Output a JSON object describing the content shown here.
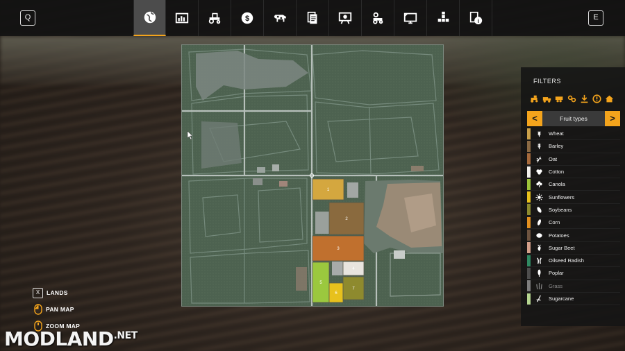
{
  "topbar": {
    "left_key": "Q",
    "right_key": "E",
    "tabs": [
      {
        "icon": "globe-icon",
        "active": true
      },
      {
        "icon": "chart-icon",
        "active": false
      },
      {
        "icon": "tractor-icon",
        "active": false
      },
      {
        "icon": "dollar-icon",
        "active": false
      },
      {
        "icon": "cow-icon",
        "active": false
      },
      {
        "icon": "contracts-icon",
        "active": false
      },
      {
        "icon": "presentation-icon",
        "active": false
      },
      {
        "icon": "vehicle-settings-icon",
        "active": false
      },
      {
        "icon": "monitor-icon",
        "active": false
      },
      {
        "icon": "production-icon",
        "active": false
      },
      {
        "icon": "help-icon",
        "active": false
      }
    ]
  },
  "map": {
    "fields": [
      {
        "number": "1",
        "color": "#d4a73f"
      },
      {
        "number": "2",
        "color": "#8a6a3e"
      },
      {
        "number": "3",
        "color": "#c0702e"
      },
      {
        "number": "4",
        "color": "#e8e4de"
      },
      {
        "number": "5",
        "color": "#9bc83e"
      },
      {
        "number": "6",
        "color": "#e7c11d"
      },
      {
        "number": "7",
        "color": "#8e8a2e"
      }
    ]
  },
  "filters": {
    "title": "FILTERS",
    "filter_icons": [
      "tractor-filter-icon",
      "truck-filter-icon",
      "trailer-filter-icon",
      "tools-filter-icon",
      "download-filter-icon",
      "alert-filter-icon",
      "home-filter-icon"
    ],
    "selector": {
      "prev": "<",
      "label": "Fruit types",
      "next": ">"
    },
    "accent": "#f4a41c",
    "fruits": [
      {
        "name": "Wheat",
        "color": "#c9a04a",
        "icon": "wheat-icon",
        "dim": false
      },
      {
        "name": "Barley",
        "color": "#8b6a44",
        "icon": "barley-icon",
        "dim": false
      },
      {
        "name": "Oat",
        "color": "#a66a3c",
        "icon": "oat-icon",
        "dim": false
      },
      {
        "name": "Cotton",
        "color": "#f2f0ec",
        "icon": "cotton-icon",
        "dim": false
      },
      {
        "name": "Canola",
        "color": "#9cc43a",
        "icon": "canola-icon",
        "dim": false
      },
      {
        "name": "Sunflowers",
        "color": "#e8c11c",
        "icon": "sunflower-icon",
        "dim": false
      },
      {
        "name": "Soybeans",
        "color": "#8c8a2e",
        "icon": "soybean-icon",
        "dim": false
      },
      {
        "name": "Corn",
        "color": "#e3901f",
        "icon": "corn-icon",
        "dim": false
      },
      {
        "name": "Potatoes",
        "color": "#6e5440",
        "icon": "potato-icon",
        "dim": false
      },
      {
        "name": "Sugar Beet",
        "color": "#d4a08a",
        "icon": "sugarbeet-icon",
        "dim": false
      },
      {
        "name": "Oilseed Radish",
        "color": "#2f8a62",
        "icon": "radish-icon",
        "dim": false
      },
      {
        "name": "Poplar",
        "color": "#4e4e4e",
        "icon": "poplar-icon",
        "dim": false
      },
      {
        "name": "Grass",
        "color": "#7e7e7e",
        "icon": "grass-icon",
        "dim": true
      },
      {
        "name": "Sugarcane",
        "color": "#b6d690",
        "icon": "sugarcane-icon",
        "dim": false
      }
    ]
  },
  "controls": [
    {
      "key": "X",
      "label": "LANDS"
    },
    {
      "key": "",
      "label": "PAN MAP"
    },
    {
      "key": "",
      "label": "ZOOM MAP"
    }
  ],
  "watermark": {
    "main": "MODLAND",
    "suffix": ".NET"
  }
}
